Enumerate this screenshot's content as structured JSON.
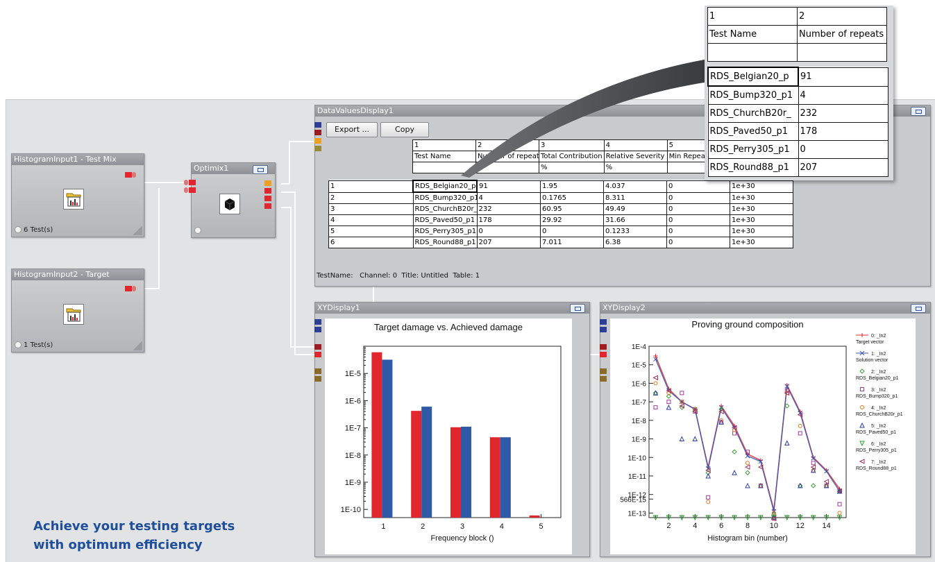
{
  "nodes": {
    "hist1": {
      "title": "HistogramInput1 - Test Mix",
      "status": "6 Test(s)"
    },
    "hist2": {
      "title": "HistogramInput2 - Target",
      "status": "1 Test(s)"
    },
    "optimix": {
      "title": "Optimix1"
    }
  },
  "data_values": {
    "title": "DataValuesDisplay1",
    "export_label": "Export ...",
    "copy_label": "Copy",
    "col_numbers": [
      "1",
      "2",
      "3",
      "4",
      "5"
    ],
    "col_names": [
      "Test Name",
      "Number of repeats",
      "Total Contribution",
      "Relative Severity",
      "Min Repeats"
    ],
    "col_units": [
      "",
      "",
      "%",
      "%",
      ""
    ],
    "rows": [
      {
        "n": "1",
        "name": "RDS_Belgian20_p",
        "repeats": "91",
        "contrib": "1.95",
        "severity": "4.037",
        "min": "0",
        "max": "1e+30"
      },
      {
        "n": "2",
        "name": "RDS_Bump320_p1",
        "repeats": "4",
        "contrib": "0.1765",
        "severity": "8.311",
        "min": "0",
        "max": "1e+30"
      },
      {
        "n": "3",
        "name": "RDS_ChurchB20r_",
        "repeats": "232",
        "contrib": "60.95",
        "severity": "49.49",
        "min": "0",
        "max": "1e+30"
      },
      {
        "n": "4",
        "name": "RDS_Paved50_p1",
        "repeats": "178",
        "contrib": "29.92",
        "severity": "31.66",
        "min": "0",
        "max": "1e+30"
      },
      {
        "n": "5",
        "name": "RDS_Perry305_p1",
        "repeats": "0",
        "contrib": "0",
        "severity": "0.1233",
        "min": "0",
        "max": "1e+30"
      },
      {
        "n": "6",
        "name": "RDS_Round88_p1",
        "repeats": "207",
        "contrib": "7.011",
        "severity": "6.38",
        "min": "0",
        "max": "1e+30"
      }
    ],
    "status_line": "TestName:   Channel: 0  Title: Untitled  Table: 1"
  },
  "callout": {
    "col_numbers": [
      "1",
      "2"
    ],
    "col_names": [
      "Test Name",
      "Number of repeats"
    ],
    "rows": [
      {
        "name": "RDS_Belgian20_p",
        "repeats": "91"
      },
      {
        "name": "RDS_Bump320_p1",
        "repeats": "4"
      },
      {
        "name": "RDS_ChurchB20r_",
        "repeats": "232"
      },
      {
        "name": "RDS_Paved50_p1",
        "repeats": "178"
      },
      {
        "name": "RDS_Perry305_p1",
        "repeats": "0"
      },
      {
        "name": "RDS_Round88_p1",
        "repeats": "207"
      }
    ]
  },
  "xy1": {
    "title": "XYDisplay1"
  },
  "xy2": {
    "title": "XYDisplay2"
  },
  "tagline": "Achieve your testing targets with optimum efficiency",
  "colors": {
    "red": "#e2262d",
    "blue": "#2f5aa8",
    "tagline": "#1f4f9a"
  },
  "chart_data": [
    {
      "type": "bar",
      "title": "Target damage vs. Achieved damage",
      "xlabel": "Frequency block ()",
      "ylabel": "",
      "log_y": true,
      "ylim": [
        5e-11,
        0.0001
      ],
      "y_tick_labels": [
        "1E-10",
        "1E-9",
        "1E-8",
        "1E-7",
        "1E-6",
        "1E-5"
      ],
      "categories": [
        "1",
        "2",
        "3",
        "4",
        "5"
      ],
      "series": [
        {
          "color": "#e2262d",
          "values": [
            6e-05,
            4.2e-07,
            1.05e-07,
            4.5e-08,
            6e-11
          ]
        },
        {
          "color": "#2f5aa8",
          "values": [
            3.2e-05,
            6e-07,
            1.1e-07,
            4.5e-08,
            null
          ]
        }
      ],
      "grid": false,
      "legend": "none"
    },
    {
      "type": "line",
      "title": "Proving ground composition",
      "xlabel": "Histogram bin (number)",
      "ylabel": "",
      "log_y": true,
      "xlim": [
        0.5,
        15.5
      ],
      "ylim": [
        5.66e-14,
        0.0001
      ],
      "x_tick_labels": [
        "2",
        "4",
        "6",
        "8",
        "10",
        "12",
        "14"
      ],
      "y_tick_labels": [
        "566E-15",
        "1E-13",
        "1E-12",
        "1E-11",
        "1E-10",
        "1E-9",
        "1E-8",
        "1E-7",
        "1E-6",
        "1E-5",
        "1E-4"
      ],
      "x": [
        1,
        2,
        3,
        4,
        5,
        6,
        7,
        8,
        9,
        10,
        11,
        12,
        13,
        14,
        15
      ],
      "legend": "right",
      "series": [
        {
          "label": "0: _In2",
          "sublabel": "Target vector",
          "marker": "+",
          "color": "#e2262d",
          "line": true,
          "values": [
            3e-05,
            5e-07,
            1e-07,
            4e-08,
            3e-11,
            6e-08,
            5e-09,
            1.5e-10,
            7e-11,
            1.5e-13,
            8e-07,
            3e-08,
            1e-10,
            2e-11,
            2e-12
          ]
        },
        {
          "label": "1: _In2",
          "sublabel": "Solution vector",
          "marker": "x",
          "color": "#3a56b0",
          "line": true,
          "values": [
            2e-05,
            4e-07,
            1e-07,
            4e-08,
            2.5e-11,
            5e-08,
            4e-09,
            1.2e-10,
            6e-11,
            1.2e-13,
            7e-07,
            2.5e-08,
            9e-11,
            1.8e-11,
            1.5e-12
          ]
        },
        {
          "label": "2: _In2",
          "sublabel": "RDS_Belgian20_p1",
          "marker": "diamond",
          "color": "#3a9a3a",
          "line": false,
          "values": [
            3e-07,
            2e-07,
            5e-08,
            4e-08,
            1.5e-11,
            4e-08,
            2e-10,
            1.5e-11,
            3e-12,
            8e-14,
            6e-08,
            3e-12,
            3e-12,
            3e-12,
            1.5e-12
          ]
        },
        {
          "label": "3: _In2",
          "sublabel": "RDS_Bump320_p1",
          "marker": "square",
          "color": "#a03aa0",
          "line": false,
          "values": [
            5e-08,
            1e-07,
            3e-07,
            3e-08,
            7e-13,
            8e-09,
            2e-09,
            2e-10,
            3e-12,
            5e-14,
            4e-07,
            2e-09,
            5e-11,
            3e-12,
            3e-13
          ]
        },
        {
          "label": "4: _In2",
          "sublabel": "RDS_ChurchB20r_p1",
          "marker": "circle",
          "color": "#e8741a",
          "line": false,
          "values": [
            1e-06,
            3e-07,
            1e-07,
            4e-08,
            4e-13,
            1e-08,
            3e-09,
            5e-11,
            3e-12,
            1e-13,
            3e-07,
            5e-09,
            2e-11,
            3e-12,
            1e-13
          ]
        },
        {
          "label": "5: _In2",
          "sublabel": "RDS_Paved50_p1",
          "marker": "triangle",
          "color": "#2c3fa0",
          "line": false,
          "values": [
            3e-07,
            5e-08,
            1e-09,
            1e-09,
            1e-11,
            8e-09,
            1.5e-11,
            3e-12,
            3e-12,
            6e-14,
            6e-10,
            3e-12,
            2e-11,
            3e-12,
            1.5e-12
          ]
        },
        {
          "label": "6: _In2",
          "sublabel": "RDS_Perry305_p1",
          "marker": "triangle-down",
          "color": "#2a9a2a",
          "line": false,
          "values": [
            5.66e-14,
            5.66e-14,
            5.66e-14,
            5.66e-14,
            5.66e-14,
            5.66e-14,
            5.66e-14,
            5.66e-14,
            5.66e-14,
            5.66e-14,
            5.66e-14,
            5.66e-14,
            5.66e-14,
            5.66e-14,
            5.66e-14
          ]
        },
        {
          "label": "7: _In2",
          "sublabel": "RDS_Round88_p1",
          "marker": "triangle-left",
          "color": "#a0305a",
          "line": false,
          "values": [
            2e-06,
            4e-07,
            6e-08,
            3e-08,
            2e-11,
            3e-08,
            4e-09,
            3e-11,
            3e-11,
            5e-14,
            3e-07,
            2e-08,
            3e-11,
            5e-12,
            1.5e-12
          ]
        }
      ]
    }
  ]
}
